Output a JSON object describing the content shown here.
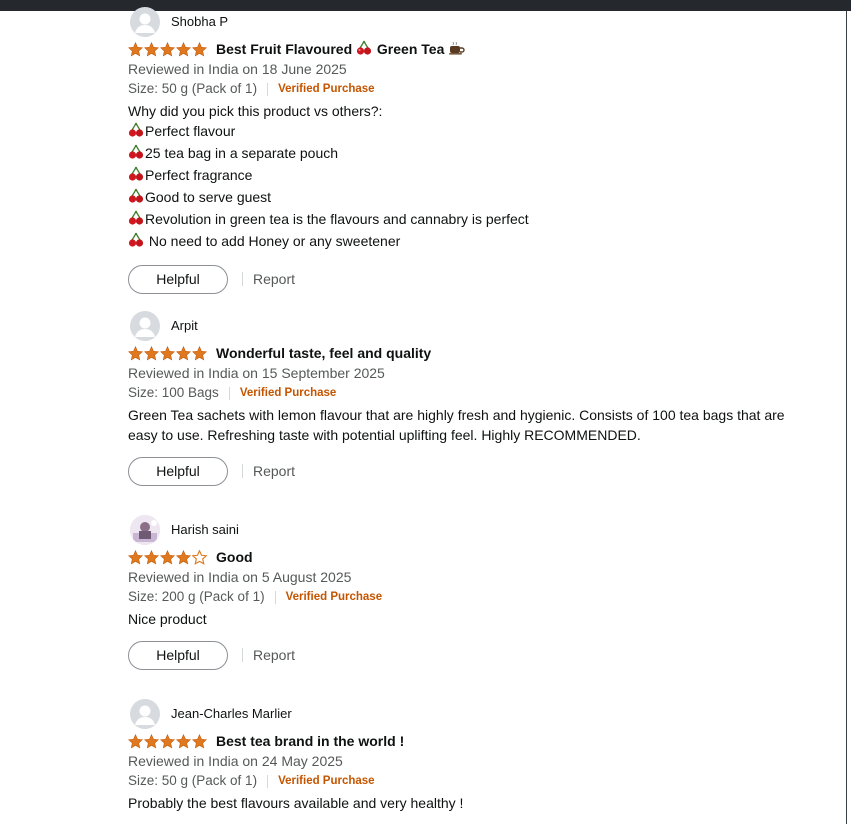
{
  "reviews": [
    {
      "reviewer": "Shobha P",
      "rating": 5,
      "title": "Best Fruit Flavoured 🍒 Green Tea ☕",
      "title_parts": [
        "Best Fruit Flavoured",
        "Green Tea"
      ],
      "date": "Reviewed in India on 18 June 2025",
      "size": "Size: 50 g (Pack of 1)",
      "verified": "Verified Purchase",
      "body_lines": [
        "Why did you pick this product vs others?:",
        "Perfect flavour",
        "25 tea bag in a separate pouch",
        "Perfect fragrance",
        "Good to serve guest",
        "Revolution in green tea is the flavours and cannabry is perfect",
        " No need to add Honey or any sweetener"
      ],
      "helpful_label": "Helpful",
      "report_label": "Report"
    },
    {
      "reviewer": "Arpit",
      "rating": 5,
      "title": "Wonderful taste, feel and quality",
      "date": "Reviewed in India on 15 September 2025",
      "size": "Size: 100 Bags",
      "verified": "Verified Purchase",
      "body_lines": [
        "Green Tea sachets with lemon flavour that are highly fresh and hygienic. Consists of 100 tea bags that are",
        "easy to use. Refreshing taste with potential uplifting feel. Highly RECOMMENDED."
      ],
      "helpful_label": "Helpful",
      "report_label": "Report"
    },
    {
      "reviewer": "Harish saini",
      "rating": 4,
      "title": "Good",
      "date": "Reviewed in India on 5 August 2025",
      "size": "Size: 200 g (Pack of 1)",
      "verified": "Verified Purchase",
      "body_lines": [
        "Nice product"
      ],
      "helpful_label": "Helpful",
      "report_label": "Report"
    },
    {
      "reviewer": "Jean-Charles Marlier",
      "rating": 5,
      "title": "Best tea brand in the world !",
      "date": "Reviewed in India on 24 May 2025",
      "size": "Size: 50 g (Pack of 1)",
      "verified": "Verified Purchase",
      "body_lines": [
        "Probably the best flavours available and very healthy !"
      ]
    }
  ],
  "colors": {
    "star": "#de7921",
    "verified": "#c45500",
    "text": "#0f1111",
    "muted": "#565959",
    "avatar_bg": "#d7dbdf"
  },
  "icons": {
    "avatar": "default-user-avatar-icon",
    "star": "star-icon",
    "cherry": "cherry-emoji-icon",
    "tea": "hot-beverage-emoji-icon"
  }
}
